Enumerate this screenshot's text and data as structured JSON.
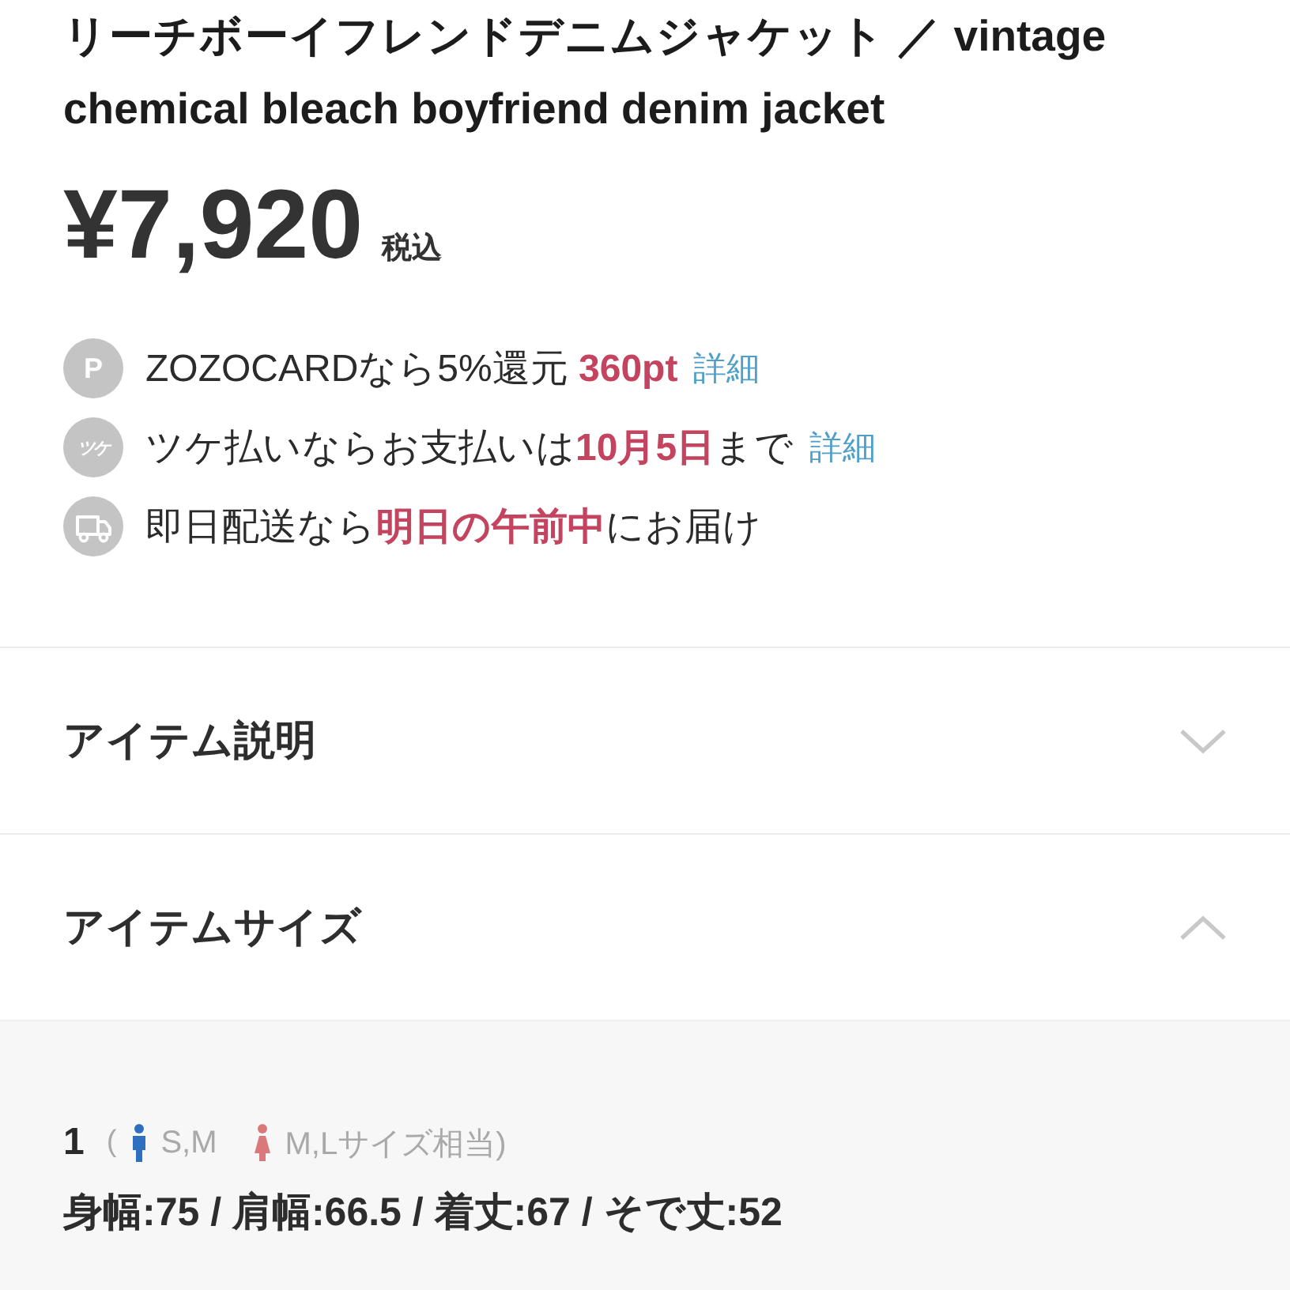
{
  "product": {
    "title": "リーチボーイフレンドデニムジャケット ／ vintage chemical bleach boyfriend denim jacket",
    "price": "¥7,920",
    "tax_note": "税込"
  },
  "perks": [
    {
      "kind": "points",
      "badge": "P",
      "segments": [
        {
          "kind": "plain",
          "text": "ZOZOCARDなら5%還元 "
        },
        {
          "kind": "highlight",
          "text": "360pt"
        }
      ],
      "link": "詳細"
    },
    {
      "kind": "pay_later",
      "badge": "ツケ",
      "segments": [
        {
          "kind": "plain",
          "text": "ツケ払いならお支払いは"
        },
        {
          "kind": "highlight",
          "text": "10月5日"
        },
        {
          "kind": "plain",
          "text": "まで"
        }
      ],
      "link": "詳細"
    },
    {
      "kind": "delivery",
      "segments": [
        {
          "kind": "plain",
          "text": "即日配送なら"
        },
        {
          "kind": "highlight",
          "text": "明日の午前中"
        },
        {
          "kind": "plain",
          "text": "にお届け"
        }
      ]
    }
  ],
  "sections": [
    {
      "title": "アイテム説明",
      "expanded": false
    },
    {
      "title": "アイテムサイズ",
      "expanded": true,
      "sizes": [
        {
          "label": "1",
          "open": "(",
          "fits": [
            {
              "kind": "men",
              "text": "S,M"
            },
            {
              "kind": "women",
              "text": "M,Lサイズ相当)"
            }
          ],
          "measurements": "身幅:75 / 肩幅:66.5 / 着丈:67 / そで丈:52"
        }
      ]
    }
  ]
}
